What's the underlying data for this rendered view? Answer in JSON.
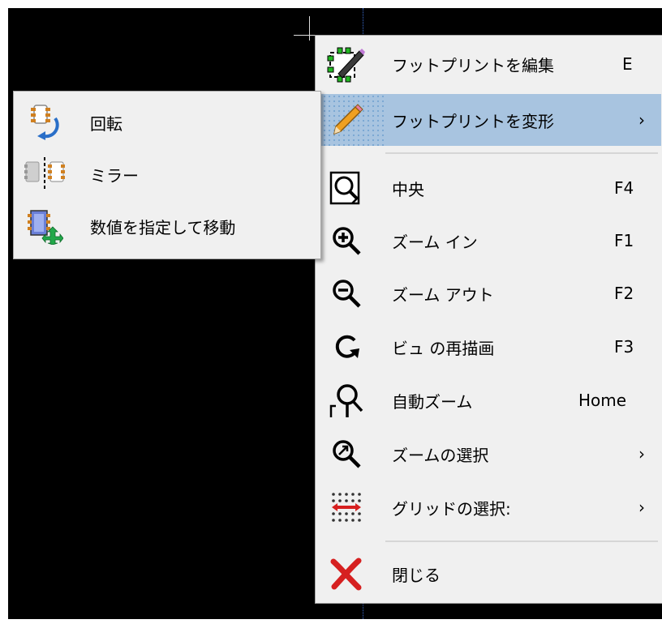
{
  "context_menu": {
    "items": [
      {
        "label": "フットプリントを編集",
        "shortcut": "E",
        "icon": "footprint-edit-icon"
      },
      {
        "label": "フットプリントを変形",
        "arrow": "›",
        "icon": "pencil-icon"
      },
      {
        "label": "中央",
        "shortcut": "F4",
        "icon": "zoom-center-icon"
      },
      {
        "label": "ズーム イン",
        "shortcut": "F1",
        "icon": "zoom-in-icon"
      },
      {
        "label": "ズーム アウト",
        "shortcut": "F2",
        "icon": "zoom-out-icon"
      },
      {
        "label": "ビュ の再描画",
        "shortcut": "F3",
        "icon": "redraw-icon"
      },
      {
        "label": "自動ズーム",
        "shortcut": "Home",
        "icon": "zoom-auto-icon"
      },
      {
        "label": "ズームの選択",
        "arrow": "›",
        "icon": "zoom-select-icon"
      },
      {
        "label": "グリッドの選択:",
        "arrow": "›",
        "icon": "grid-icon"
      },
      {
        "label": "閉じる",
        "icon": "close-icon"
      }
    ]
  },
  "transform_submenu": {
    "items": [
      {
        "label": "回転",
        "icon": "rotate-icon"
      },
      {
        "label": "ミラー",
        "icon": "mirror-icon"
      },
      {
        "label": "数値を指定して移動",
        "icon": "move-exact-icon"
      }
    ]
  },
  "colors": {
    "canvas": "#000000",
    "menu_bg": "#f0f0f0",
    "highlight": "#a8c4e0",
    "close_icon": "#d62020"
  }
}
